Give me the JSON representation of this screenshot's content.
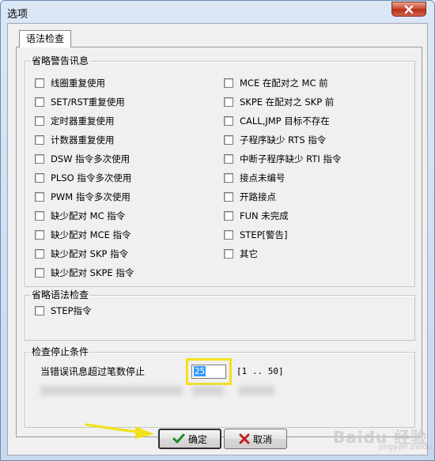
{
  "window": {
    "title": "选项"
  },
  "tab": {
    "label": "语法检查"
  },
  "group_warnings": {
    "title": "省略警告讯息",
    "left_items": [
      "线圈重复使用",
      "SET/RST重复使用",
      "定时器重复使用",
      "计数器重复使用",
      "DSW 指令多次使用",
      "PLSO 指令多次使用",
      "PWM 指令多次使用",
      "缺少配对 MC 指令",
      "缺少配对 MCE 指令",
      "缺少配对 SKP 指令",
      "缺少配对 SKPE 指令"
    ],
    "right_items": [
      "MCE 在配对之 MC 前",
      "SKPE 在配对之 SKP 前",
      "CALL,JMP 目标不存在",
      "子程序缺少 RTS 指令",
      "中断子程序缺少 RTI 指令",
      "接点未编号",
      "开路接点",
      "FUN 未完成",
      "STEP[警告]",
      "其它"
    ]
  },
  "group_syntax": {
    "title": "省略语法检查",
    "items": [
      "STEP指令"
    ]
  },
  "group_stop": {
    "title": "检查停止条件",
    "label": "当错误讯息超过笔数停止",
    "value": "25",
    "range": "[1 .. 50]"
  },
  "buttons": {
    "ok": "确定",
    "cancel": "取消"
  },
  "watermark": {
    "brand": "Baidu 经验",
    "url": "jingyan.baidu.com"
  },
  "colors": {
    "highlight": "#f2e11a",
    "arrow": "#f2e11a",
    "ok_check": "#1f8a1f",
    "cancel_x": "#c0201a"
  }
}
